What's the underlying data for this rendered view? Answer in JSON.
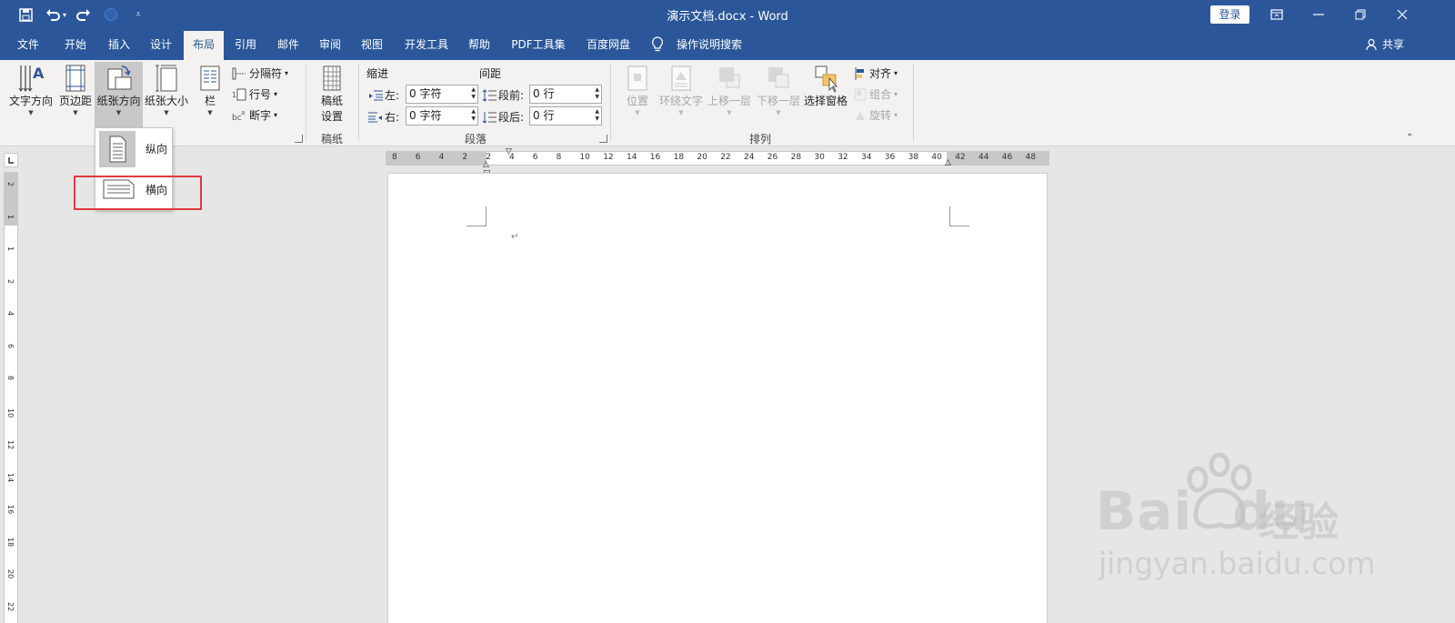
{
  "titlebar": {
    "title": "演示文档.docx  -  Word",
    "login": "登录"
  },
  "menubar": {
    "tabs": [
      "文件",
      "开始",
      "插入",
      "设计",
      "布局",
      "引用",
      "邮件",
      "审阅",
      "视图",
      "开发工具",
      "帮助",
      "PDF工具集",
      "百度网盘"
    ],
    "active_index": 4,
    "tell_me": "操作说明搜索",
    "share": "共享"
  },
  "ribbon": {
    "page_setup": {
      "text_direction": "文字方向",
      "margins": "页边距",
      "orientation": "纸张方向",
      "size": "纸张大小",
      "columns": "栏",
      "breaks": "分隔符",
      "line_numbers": "行号",
      "hyphenation": "断字"
    },
    "manuscript": {
      "button_line1": "稿纸",
      "button_line2": "设置",
      "group_label": "稿纸"
    },
    "paragraph": {
      "indent_label": "缩进",
      "spacing_label": "间距",
      "left_label": "左:",
      "right_label": "右:",
      "before_label": "段前:",
      "after_label": "段后:",
      "indent_left": "0 字符",
      "indent_right": "0 字符",
      "spacing_before": "0 行",
      "spacing_after": "0 行",
      "group_label": "段落"
    },
    "arrange": {
      "position": "位置",
      "wrap_text": "环绕文字",
      "bring_forward": "上移一层",
      "send_backward": "下移一层",
      "selection_pane": "选择窗格",
      "align": "对齐",
      "group": "组合",
      "rotate": "旋转",
      "group_label": "排列"
    }
  },
  "orientation_menu": {
    "portrait": "纵向",
    "landscape": "横向"
  },
  "ruler": {
    "h_ticks": [
      "8",
      "6",
      "4",
      "2",
      "2",
      "4",
      "6",
      "8",
      "10",
      "12",
      "14",
      "16",
      "18",
      "20",
      "22",
      "24",
      "26",
      "28",
      "30",
      "32",
      "34",
      "36",
      "38",
      "40",
      "42",
      "44",
      "46",
      "48"
    ],
    "v_ticks": [
      "2",
      "1",
      "1",
      "2",
      "4",
      "6",
      "8",
      "10",
      "12",
      "14",
      "16",
      "18",
      "20",
      "22"
    ]
  },
  "document": {
    "paragraph_mark": "↵"
  },
  "watermark": {
    "brand": "Bai",
    "brand2": "du",
    "suffix": "经验",
    "url": "jingyan.baidu.com"
  },
  "colors": {
    "brand": "#2b579a",
    "ribbon_bg": "#f3f2f1",
    "highlight_box": "#e0393e"
  }
}
